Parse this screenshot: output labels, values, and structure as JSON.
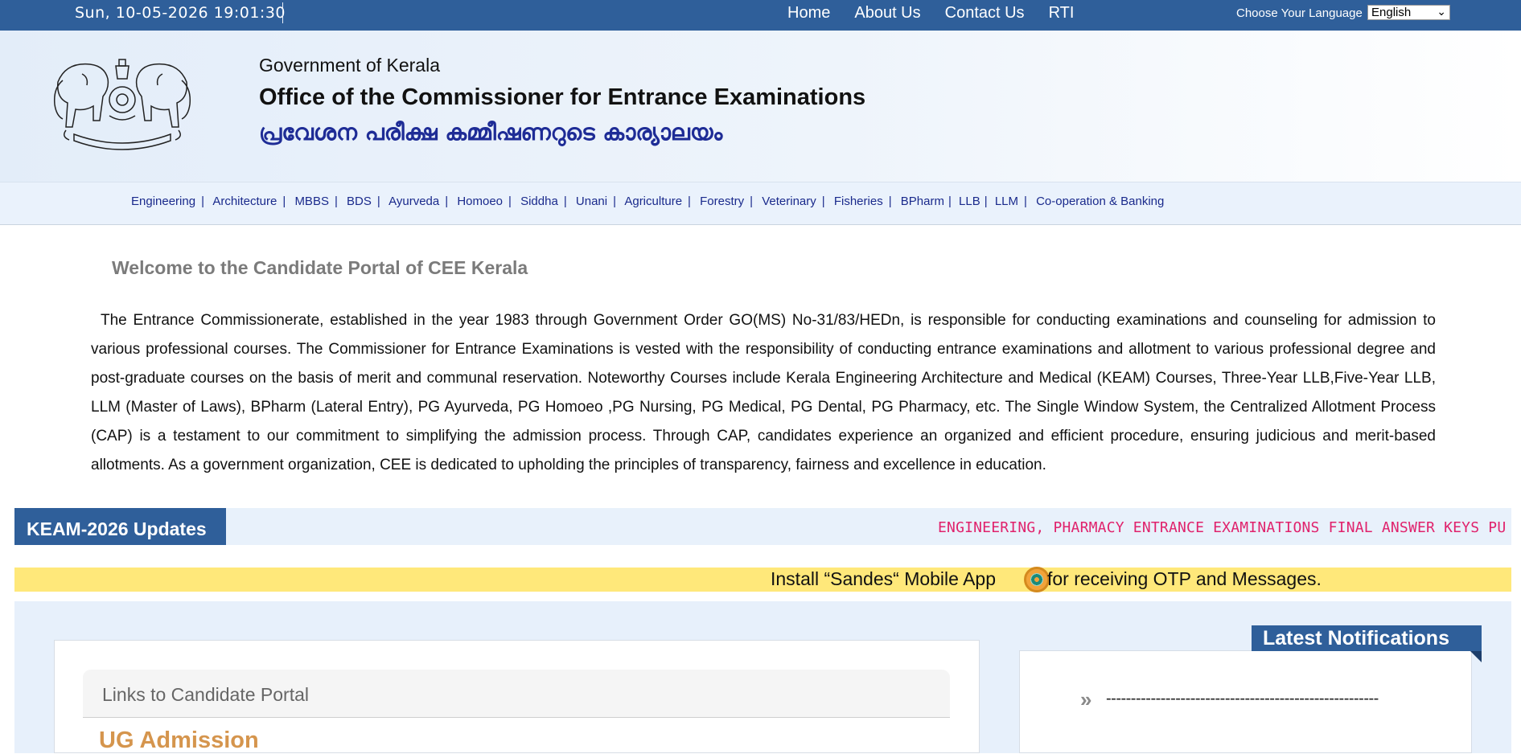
{
  "topbar": {
    "datetime": "Sun, 10-05-2026 19:01:30",
    "nav": [
      {
        "label": "Home"
      },
      {
        "label": "About Us"
      },
      {
        "label": "Contact Us"
      },
      {
        "label": "RTI"
      }
    ],
    "language_label": "Choose Your Language",
    "language_selected": "English"
  },
  "header": {
    "government": "Government of Kerala",
    "office": "Office of the Commissioner for Entrance Examinations",
    "office_malayalam": "പ്രവേശന പരീക്ഷ കമ്മീഷണറുടെ കാര്യാലയം"
  },
  "courses": [
    "Engineering",
    "Architecture",
    "MBBS",
    "BDS",
    "Ayurveda",
    "Homoeo",
    "Siddha",
    "Unani",
    "Agriculture",
    "Forestry",
    "Veterinary",
    "Fisheries",
    "BPharm",
    "LLB",
    "LLM",
    "Co-operation & Banking"
  ],
  "welcome": {
    "title": "Welcome to the Candidate Portal of CEE Kerala",
    "body": "The Entrance Commissionerate, established in the year 1983 through Government Order GO(MS) No-31/83/HEDn, is responsible for conducting examinations and counseling for admission to various professional courses. The Commissioner for Entrance Examinations is vested with the responsibility of conducting entrance examinations and allotment to various professional degree and post-graduate courses on the basis of merit and communal reservation. Noteworthy Courses include Kerala Engineering Architecture and Medical (KEAM) Courses, Three-Year LLB,Five-Year LLB, LLM (Master of Laws), BPharm (Lateral Entry), PG Ayurveda, PG Homoeo ,PG Nursing, PG Medical, PG Dental, PG Pharmacy, etc. The Single Window System, the Centralized Allotment Process (CAP) is a testament to our commitment to simplifying the admission process. Through CAP, candidates experience an organized and efficient procedure, ensuring judicious and merit-based allotments. As a government organization, CEE is dedicated to upholding the principles of transparency, fairness and excellence in education."
  },
  "updates": {
    "label": "KEAM-2026 Updates",
    "ticker": "ENGINEERING, PHARMACY ENTRANCE EXAMINATIONS FINAL ANSWER KEYS PU"
  },
  "sandes": {
    "text_before": "Install “Sandes“ Mobile App",
    "text_after": "for receiving OTP and Messages."
  },
  "portal": {
    "links_title": "Links to Candidate Portal",
    "ug_title": "UG Admission"
  },
  "notifications": {
    "title": "Latest Notifications",
    "item": "-------------------------------------------------------"
  },
  "colors": {
    "topbar": "#2f5f9a",
    "course_link": "#1a2a8c",
    "malayalam_title": "#1e2c96",
    "ticker": "#e0226c",
    "sandes_banner": "#ffe87a",
    "ug_title": "#d5954d"
  }
}
